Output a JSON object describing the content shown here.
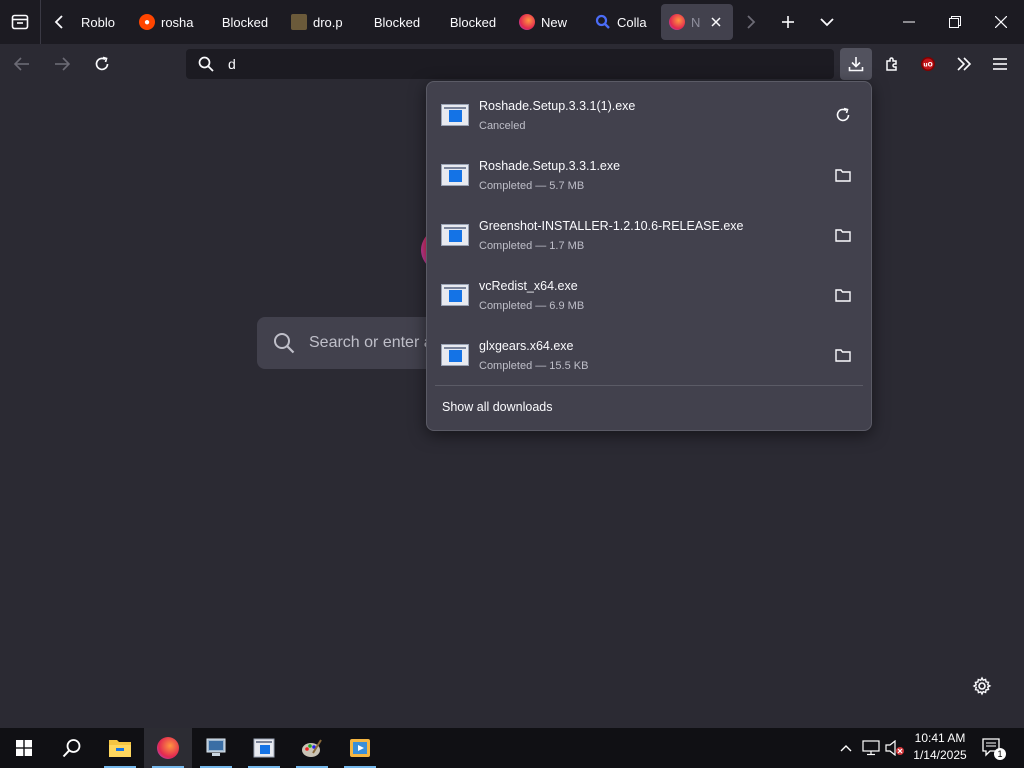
{
  "browser": {
    "tabs": [
      {
        "label": "Roblo",
        "icon": "none"
      },
      {
        "label": "rosha",
        "icon": "reddit-icon"
      },
      {
        "label": "Blocked",
        "icon": "none"
      },
      {
        "label": "dro.p",
        "icon": "page-icon"
      },
      {
        "label": "Blocked",
        "icon": "none"
      },
      {
        "label": "Blocked",
        "icon": "none"
      },
      {
        "label": "New",
        "icon": "firefox-icon"
      },
      {
        "label": "Colla",
        "icon": "search-icon"
      },
      {
        "label": "N",
        "icon": "firefox-icon"
      }
    ],
    "url_value": "d"
  },
  "newtab": {
    "search_placeholder": "Search or enter ad"
  },
  "downloads": {
    "items": [
      {
        "filename": "Roshade.Setup.3.3.1(1).exe",
        "status": "Canceled",
        "action": "retry-icon"
      },
      {
        "filename": "Roshade.Setup.3.3.1.exe",
        "status": "Completed — 5.7 MB",
        "action": "folder-icon"
      },
      {
        "filename": "Greenshot-INSTALLER-1.2.10.6-RELEASE.exe",
        "status": "Completed — 1.7 MB",
        "action": "folder-icon"
      },
      {
        "filename": "vcRedist_x64.exe",
        "status": "Completed — 6.9 MB",
        "action": "folder-icon"
      },
      {
        "filename": "glxgears.x64.exe",
        "status": "Completed — 15.5 KB",
        "action": "folder-icon"
      }
    ],
    "show_all_label": "Show all downloads"
  },
  "taskbar": {
    "time": "10:41 AM",
    "date": "1/14/2025",
    "notification_count": "1"
  },
  "colors": {
    "accent": "#1473e6",
    "panel_bg": "#42414d",
    "toolbar_bg": "#2b2a33"
  }
}
